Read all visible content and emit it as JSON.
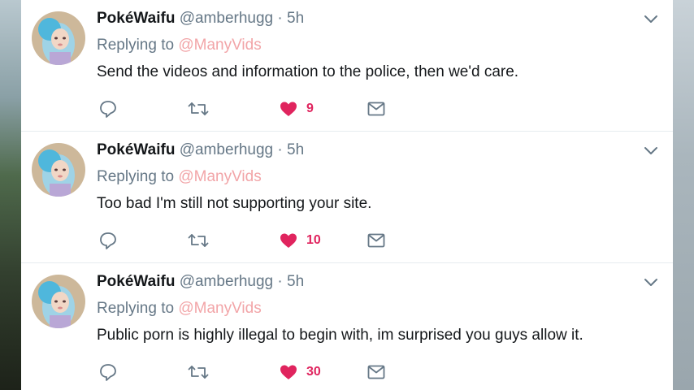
{
  "theme": {
    "like_color": "#e0245e",
    "mention_color": "#f2a5a8",
    "meta_color": "#657786",
    "text_color": "#14171a"
  },
  "tweets": [
    {
      "display_name": "PokéWaifu",
      "handle": "@amberhugg",
      "separator": "·",
      "time": "5h",
      "replying_label": "Replying to",
      "replying_to": "@ManyVids",
      "text": "Send the videos and information to the police, then we'd care.",
      "likes": "9"
    },
    {
      "display_name": "PokéWaifu",
      "handle": "@amberhugg",
      "separator": "·",
      "time": "5h",
      "replying_label": "Replying to",
      "replying_to": "@ManyVids",
      "text": "Too bad I'm still not supporting your site.",
      "likes": "10"
    },
    {
      "display_name": "PokéWaifu",
      "handle": "@amberhugg",
      "separator": "·",
      "time": "5h",
      "replying_label": "Replying to",
      "replying_to": "@ManyVids",
      "text": "Public porn is highly illegal to begin with, im surprised you guys allow it.",
      "likes": "30"
    }
  ],
  "icons": [
    "reply-icon",
    "retweet-icon",
    "heart-icon",
    "mail-icon",
    "chevron-down-icon",
    "avatar"
  ]
}
